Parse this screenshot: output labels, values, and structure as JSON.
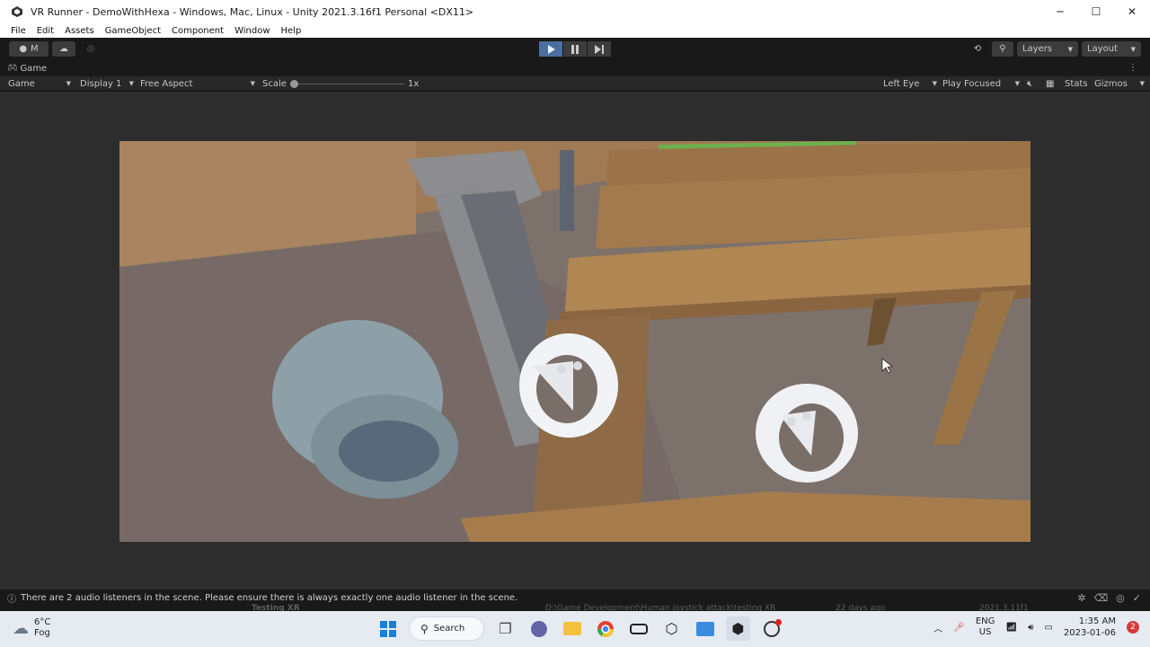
{
  "window": {
    "title": "VR Runner - DemoWithHexa - Windows, Mac, Linux - Unity 2021.3.16f1 Personal <DX11>",
    "minimize": "─",
    "maximize": "☐",
    "close": "✕"
  },
  "menu": [
    "File",
    "Edit",
    "Assets",
    "GameObject",
    "Component",
    "Window",
    "Help"
  ],
  "toolbar": {
    "account": "M",
    "layers": "Layers",
    "layout": "Layout"
  },
  "tab": {
    "label": "Game"
  },
  "gametools": {
    "mode": "Game",
    "display": "Display 1",
    "aspect": "Free Aspect",
    "scale_label": "Scale",
    "scale_value": "1x",
    "eye": "Left Eye",
    "play_mode": "Play Focused",
    "stats": "Stats",
    "gizmos": "Gizmos"
  },
  "status": {
    "message": "There are 2 audio listeners in the scene. Please ensure there is always exactly one audio listener in the scene."
  },
  "ghost": {
    "name": "Testing XR",
    "path": "D:\\Game Development\\Human joystick attack\\testing XR",
    "age": "22 days ago",
    "version": "2021.3.11f1"
  },
  "taskbar": {
    "temperature": "6°C",
    "condition": "Fog",
    "search": "Search",
    "lang": "ENG",
    "region": "US",
    "time": "1:35 AM",
    "date": "2023-01-06",
    "notifications": "2"
  },
  "colors": {
    "play_active": "#4a6ea0",
    "editor_bg": "#191919",
    "viewport_bg": "#7a6e66"
  }
}
